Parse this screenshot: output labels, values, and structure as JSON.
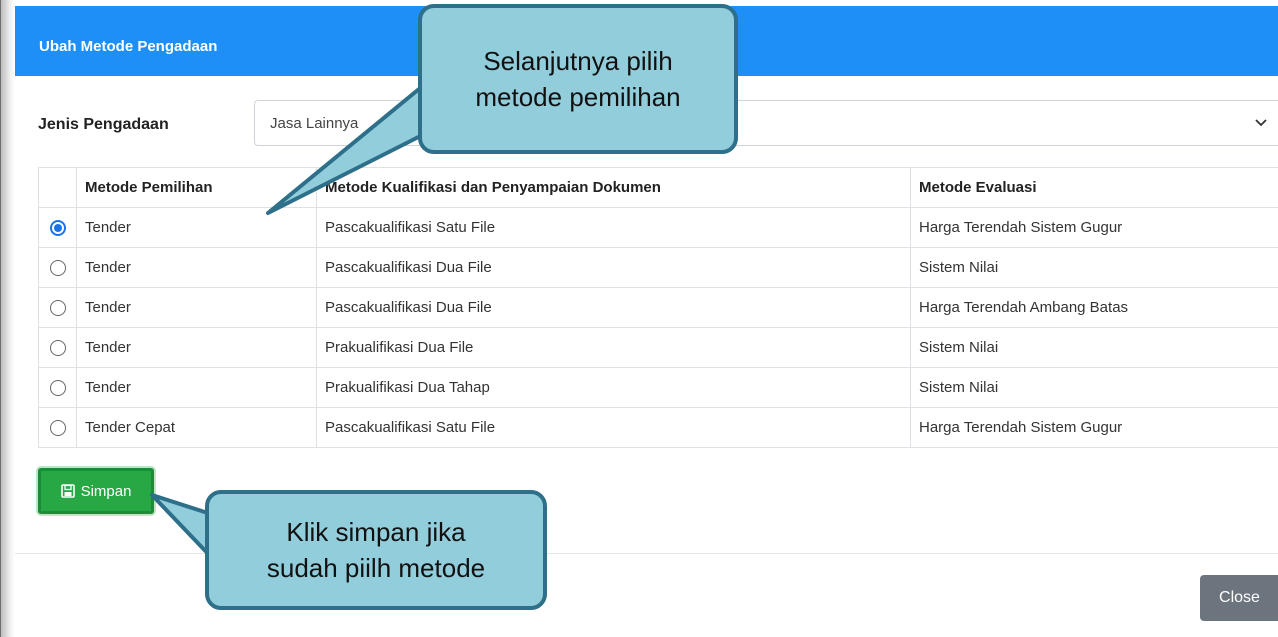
{
  "modal": {
    "title": "Ubah Metode Pengadaan",
    "header_color": "#1e8ff7"
  },
  "form": {
    "label": "Jenis Pengadaan",
    "selected_value": "Jasa Lainnya"
  },
  "table": {
    "headers": [
      "",
      "Metode Pemilihan",
      "Metode Kualifikasi dan Penyampaian Dokumen",
      "Metode Evaluasi"
    ],
    "rows": [
      {
        "selected": true,
        "pemilihan": "Tender",
        "kualifikasi": "Pascakualifikasi Satu File",
        "evaluasi": "Harga Terendah Sistem Gugur"
      },
      {
        "selected": false,
        "pemilihan": "Tender",
        "kualifikasi": "Pascakualifikasi Dua File",
        "evaluasi": "Sistem Nilai"
      },
      {
        "selected": false,
        "pemilihan": "Tender",
        "kualifikasi": "Pascakualifikasi Dua File",
        "evaluasi": "Harga Terendah Ambang Batas"
      },
      {
        "selected": false,
        "pemilihan": "Tender",
        "kualifikasi": "Prakualifikasi Dua File",
        "evaluasi": "Sistem Nilai"
      },
      {
        "selected": false,
        "pemilihan": "Tender",
        "kualifikasi": "Prakualifikasi Dua Tahap",
        "evaluasi": "Sistem Nilai"
      },
      {
        "selected": false,
        "pemilihan": "Tender Cepat",
        "kualifikasi": "Pascakualifikasi Satu File",
        "evaluasi": "Harga Terendah Sistem Gugur"
      }
    ]
  },
  "buttons": {
    "save_label": "Simpan",
    "save_icon": "save-icon",
    "close_label": "Close"
  },
  "callouts": {
    "select_method": [
      "Selanjutnya pilih",
      "metode pemilihan"
    ],
    "click_save": [
      "Klik simpan jika",
      "sudah piilh metode"
    ],
    "fill_color": "#92cddc",
    "border_color": "#2e6f8a"
  },
  "colors": {
    "save_button": "#28a745",
    "close_button": "#6c757d",
    "radio_selected": "#1a73e8"
  }
}
